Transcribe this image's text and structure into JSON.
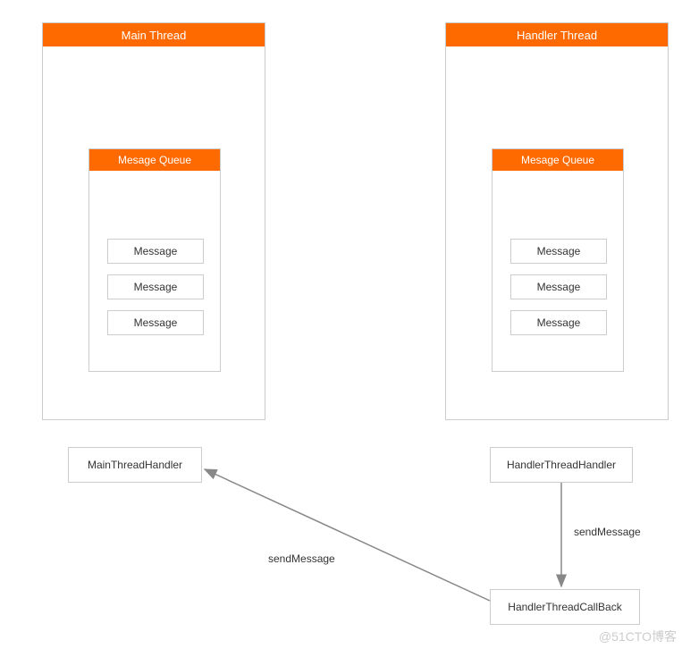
{
  "threads": {
    "main": {
      "title": "Main Thread",
      "queue_title": "Mesage Queue",
      "messages": [
        "Message",
        "Message",
        "Message"
      ]
    },
    "handler": {
      "title": "Handler Thread",
      "queue_title": "Mesage Queue",
      "messages": [
        "Message",
        "Message",
        "Message"
      ]
    }
  },
  "boxes": {
    "main_handler": "MainThreadHandler",
    "handler_thread_handler": "HandlerThreadHandler",
    "handler_callback": "HandlerThreadCallBack"
  },
  "labels": {
    "send_message_1": "sendMessage",
    "send_message_2": "sendMessage"
  },
  "watermark": "@51CTO博客",
  "colors": {
    "accent": "#ff6a00",
    "border": "#cccccc",
    "arrow": "#888888"
  }
}
